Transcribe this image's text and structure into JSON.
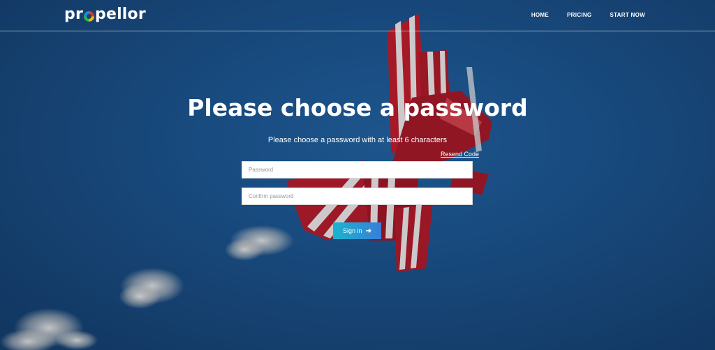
{
  "brand": {
    "name_pre": "pr",
    "name_post": "pellor"
  },
  "nav": {
    "items": [
      {
        "label": "HOME"
      },
      {
        "label": "PRICING"
      },
      {
        "label": "START NOW"
      }
    ]
  },
  "main": {
    "title": "Please choose a password",
    "subtitle": "Please choose a password with at least 6 characters",
    "resend_label": "Resend Code",
    "password_placeholder": "Password",
    "confirm_placeholder": "Confirm password",
    "signin_label": "Sign in",
    "signin_icon": "arrow-right-icon"
  },
  "colors": {
    "background": "#1a4f86",
    "button_start": "#18b5cf",
    "button_end": "#3a7ed8"
  }
}
